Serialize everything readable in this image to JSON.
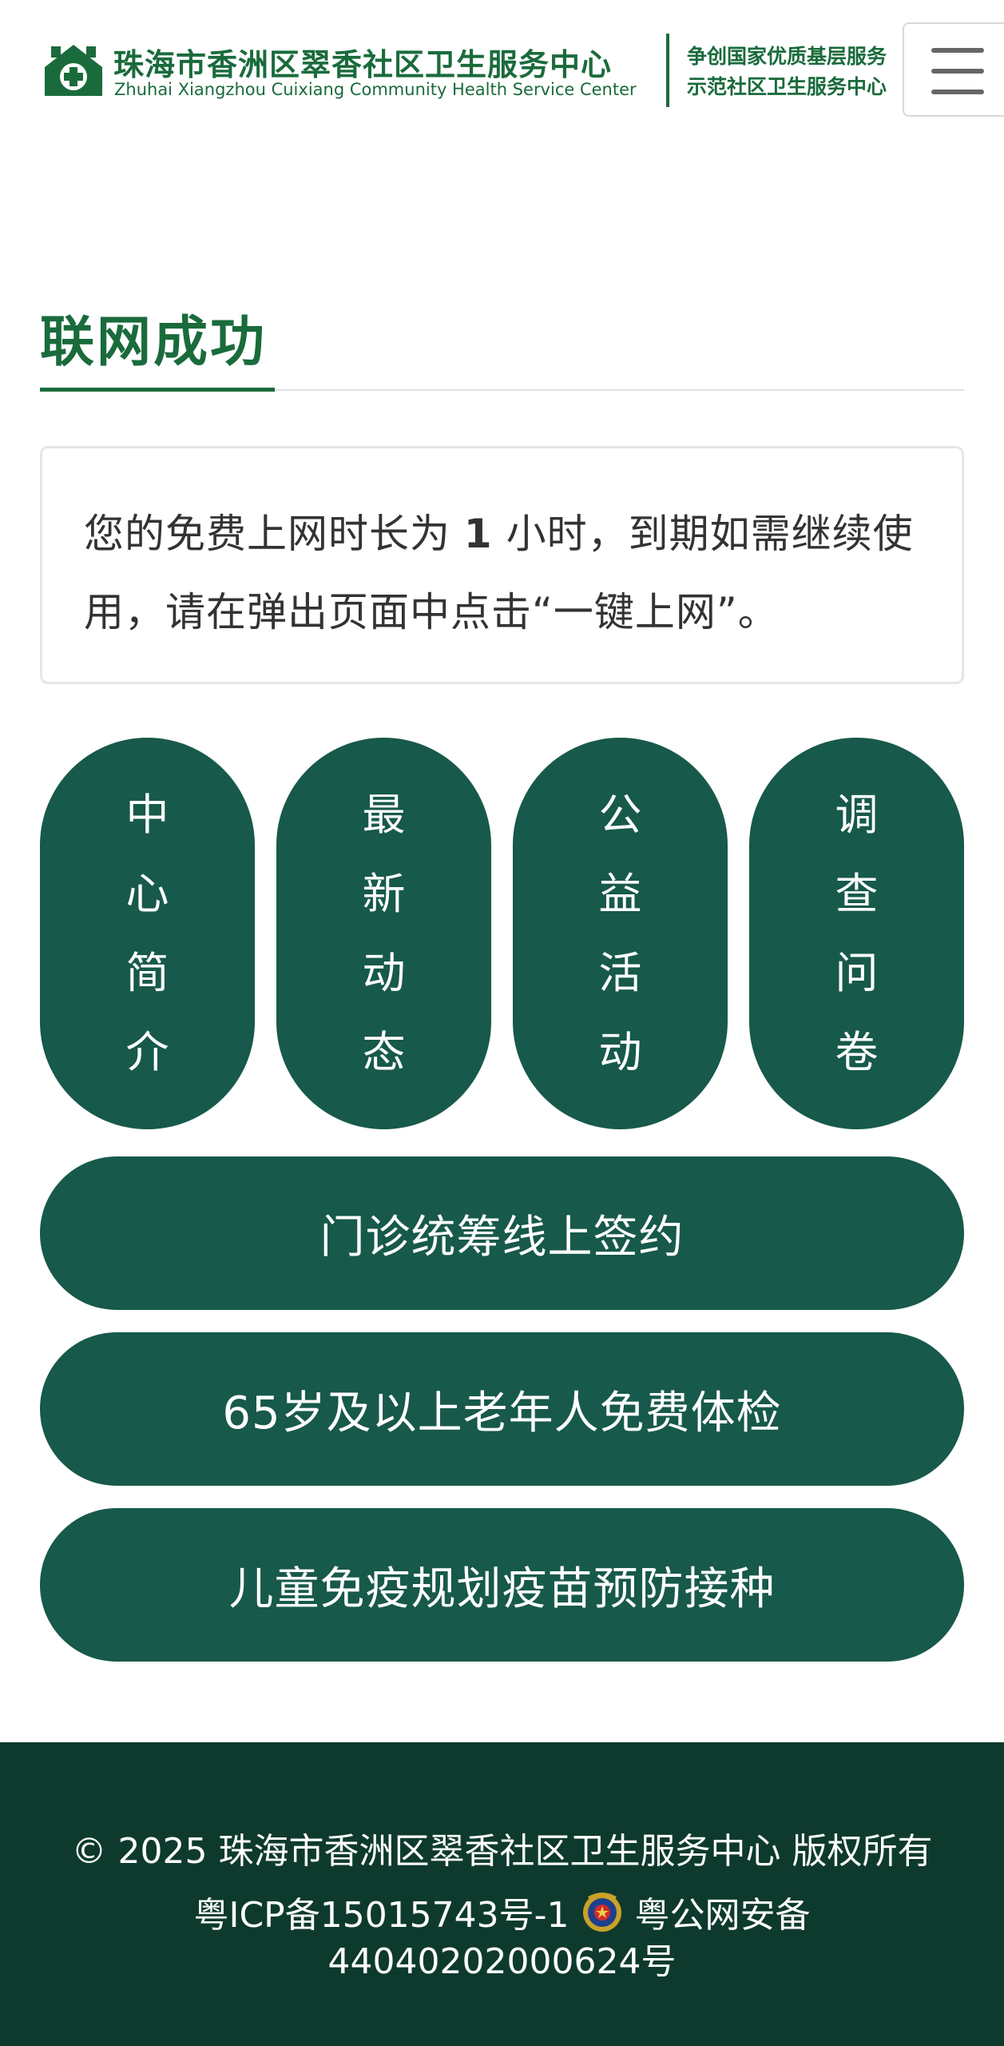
{
  "header": {
    "org_name": "珠海市香洲区翠香社区卫生服务中心",
    "org_name_en": "Zhuhai Xiangzhou Cuixiang Community Health Service Center",
    "slogan_line1": "争创国家优质基层服务",
    "slogan_line2": "示范社区卫生服务中心",
    "logo_icon": "health-center-logo-icon",
    "menu_icon": "hamburger-menu-icon"
  },
  "page": {
    "title": "联网成功"
  },
  "notice": {
    "text_before": "您的免费上网时长为 ",
    "hours": "1",
    "text_after": " 小时，到期如需继续使用，请在弹出页面中点击“一键上网”。"
  },
  "pills": [
    {
      "label": "中心简介"
    },
    {
      "label": "最新动态"
    },
    {
      "label": "公益活动"
    },
    {
      "label": "调查问卷"
    }
  ],
  "buttons": [
    {
      "label": "门诊统筹线上签约"
    },
    {
      "label": "65岁及以上老年人免费体检"
    },
    {
      "label": "儿童免疫规划疫苗预防接种"
    }
  ],
  "footer": {
    "copyright": "© 2025 珠海市香洲区翠香社区卫生服务中心 版权所有",
    "icp": "粤ICP备15015743号-1",
    "police_icon": "police-badge-icon",
    "beian_label": "粤公网安备",
    "beian_number": "44040202000624号"
  },
  "colors": {
    "brand_green": "#1a6b3c",
    "button_green": "#17594a",
    "footer_bg": "#0e3a2e"
  }
}
